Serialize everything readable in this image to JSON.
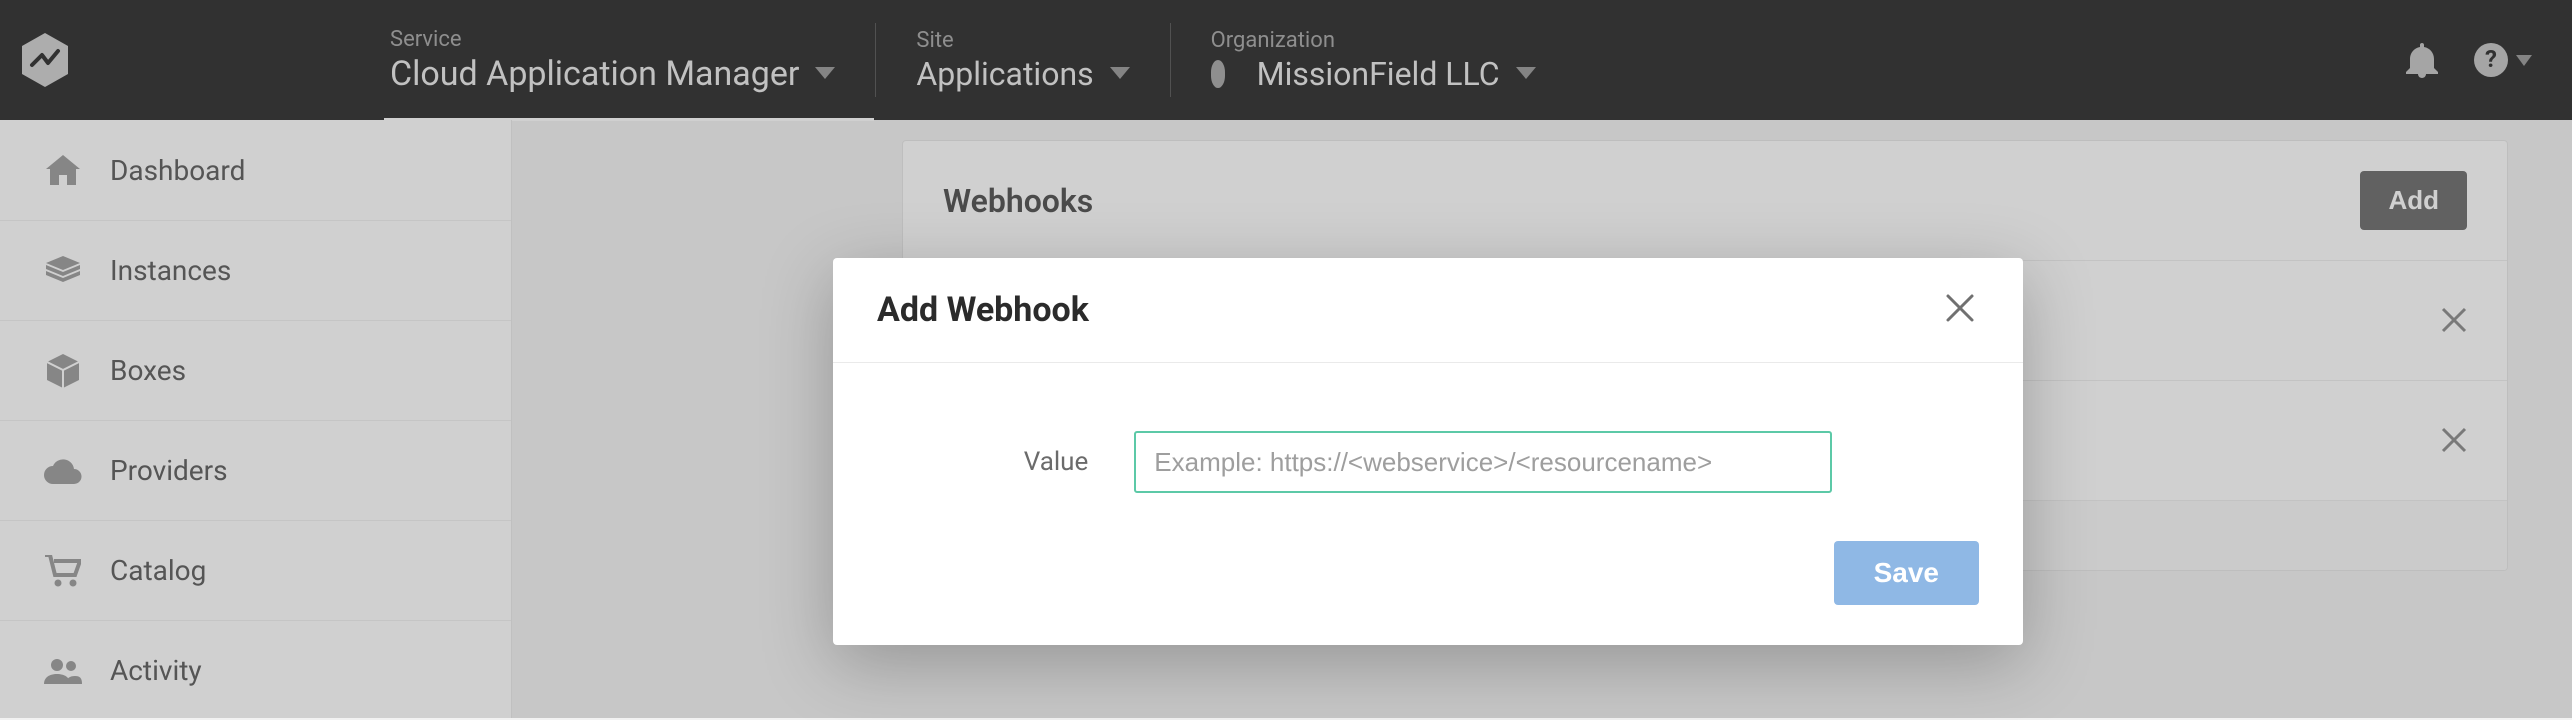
{
  "header": {
    "service_label": "Service",
    "service_value": "Cloud Application Manager",
    "site_label": "Site",
    "site_value": "Applications",
    "org_label": "Organization",
    "org_value": "MissionField LLC"
  },
  "sidebar": {
    "items": [
      {
        "label": "Dashboard",
        "icon": "home-icon"
      },
      {
        "label": "Instances",
        "icon": "layers-icon"
      },
      {
        "label": "Boxes",
        "icon": "cube-icon"
      },
      {
        "label": "Providers",
        "icon": "cloud-icon"
      },
      {
        "label": "Catalog",
        "icon": "cart-icon"
      },
      {
        "label": "Activity",
        "icon": "people-icon"
      }
    ]
  },
  "webhooks": {
    "title": "Webhooks",
    "add_label": "Add"
  },
  "modal": {
    "title": "Add Webhook",
    "value_label": "Value",
    "value_placeholder": "Example: https://<webservice>/<resourcename>",
    "save_label": "Save"
  },
  "colors": {
    "accent_input_border": "#5cc9a7",
    "save_button_bg": "#8fb8e5",
    "add_button_bg": "#555555"
  }
}
